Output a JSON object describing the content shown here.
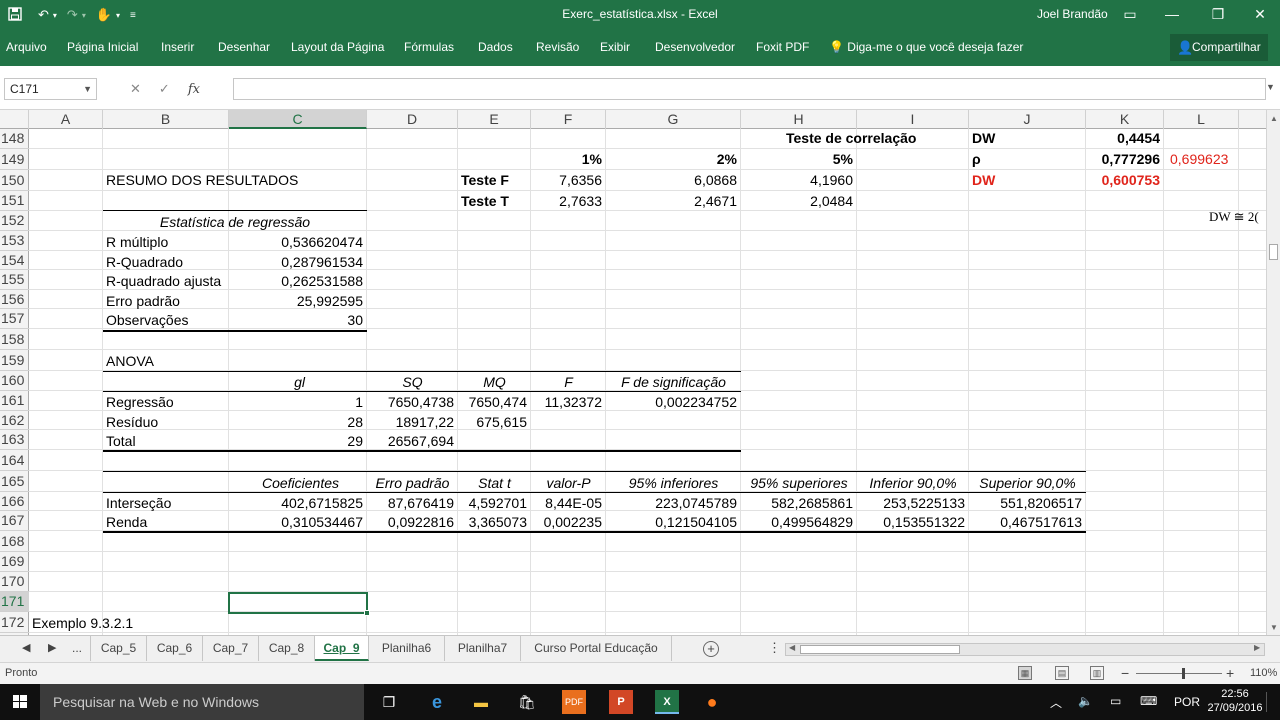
{
  "window": {
    "title": "Exerc_estatística.xlsx - Excel",
    "user": "Joel Brandão"
  },
  "ribbon": {
    "tabs": [
      "Arquivo",
      "Página Inicial",
      "Inserir",
      "Desenhar",
      "Layout da Página",
      "Fórmulas",
      "Dados",
      "Revisão",
      "Exibir",
      "Desenvolvedor",
      "Foxit PDF"
    ],
    "tell_me": "Diga-me o que você deseja fazer",
    "share": "Compartilhar"
  },
  "formula_bar": {
    "name_box": "C171",
    "fx_label": "fx",
    "formula": ""
  },
  "columns": [
    "A",
    "B",
    "C",
    "D",
    "E",
    "F",
    "G",
    "H",
    "I",
    "J",
    "K",
    "L"
  ],
  "rows": [
    "148",
    "149",
    "150",
    "151",
    "152",
    "153",
    "154",
    "155",
    "156",
    "157",
    "158",
    "159",
    "160",
    "161",
    "162",
    "163",
    "164",
    "165",
    "166",
    "167",
    "168",
    "169",
    "170",
    "171",
    "172"
  ],
  "cells": {
    "teste_correlacao": "Teste de correlação",
    "dw_label": "DW",
    "dw_value": "0,4454",
    "pct_1": "1%",
    "pct_2": "2%",
    "pct_5": "5%",
    "rho_label": "ρ",
    "rho_value": "0,777296",
    "rho_red": "0,699623",
    "resumo": "RESUMO DOS RESULTADOS",
    "teste_f": "Teste F",
    "f_1": "7,6356",
    "f_2": "6,0868",
    "f_5": "4,1960",
    "dw_red_label": "DW",
    "dw_red_value": "0,600753",
    "teste_t": "Teste T",
    "t_1": "2,7633",
    "t_2": "2,4671",
    "t_5": "2,0484",
    "estat_regressao": "Estatística de regressão",
    "r_multiplo": "R múltiplo",
    "r_multiplo_v": "0,536620474",
    "r_quadrado": "R-Quadrado",
    "r_quadrado_v": "0,287961534",
    "r_quad_aj": "R-quadrado ajusta",
    "r_quad_aj_v": "0,262531588",
    "erro_padrao": "Erro padrão",
    "erro_padrao_v": "25,992595",
    "observacoes": "Observações",
    "observacoes_v": "30",
    "anova": "ANOVA",
    "h_gl": "gl",
    "h_sq": "SQ",
    "h_mq": "MQ",
    "h_f": "F",
    "h_fsig": "F de significação",
    "regressao": "Regressão",
    "reg_gl": "1",
    "reg_sq": "7650,4738",
    "reg_mq": "7650,474",
    "reg_f": "11,32372",
    "reg_fsig": "0,002234752",
    "residuo": "Resíduo",
    "res_gl": "28",
    "res_sq": "18917,22",
    "res_mq": "675,615",
    "total": "Total",
    "tot_gl": "29",
    "tot_sq": "26567,694",
    "h_coef": "Coeficientes",
    "h_erro": "Erro padrão",
    "h_statt": "Stat t",
    "h_valorp": "valor-P",
    "h_inf95": "95% inferiores",
    "h_sup95": "95% superiores",
    "h_inf90": "Inferior 90,0%",
    "h_sup90": "Superior 90,0%",
    "intersecao": "Interseção",
    "int_coef": "402,6715825",
    "int_erro": "87,676419",
    "int_statt": "4,592701",
    "int_valorp": "8,44E-05",
    "int_inf95": "223,0745789",
    "int_sup95": "582,2685861",
    "int_inf90": "253,5225133",
    "int_sup90": "551,8206517",
    "renda": "Renda",
    "ren_coef": "0,310534467",
    "ren_erro": "0,0922816",
    "ren_statt": "3,365073",
    "ren_valorp": "0,002235",
    "ren_inf95": "0,121504105",
    "ren_sup95": "0,499564829",
    "ren_inf90": "0,153551322",
    "ren_sup90": "0,467517613",
    "exemplo": "Exemplo 9.3.2.1",
    "dw_formula": "DW ≅ 2("
  },
  "sheets": {
    "more": "...",
    "tabs": [
      "Cap_5",
      "Cap_6",
      "Cap_7",
      "Cap_8",
      "Cap_9",
      "Planilha6",
      "Planilha7",
      "Curso Portal Educação"
    ],
    "active": "Cap_9"
  },
  "status": {
    "ready": "Pronto",
    "zoom": "110%"
  },
  "taskbar": {
    "search": "Pesquisar na Web e no Windows",
    "lang": "POR",
    "time": "22:56",
    "date": "27/09/2016"
  },
  "colors": {
    "excel_green": "#217346",
    "red_text": "#e0241b"
  }
}
